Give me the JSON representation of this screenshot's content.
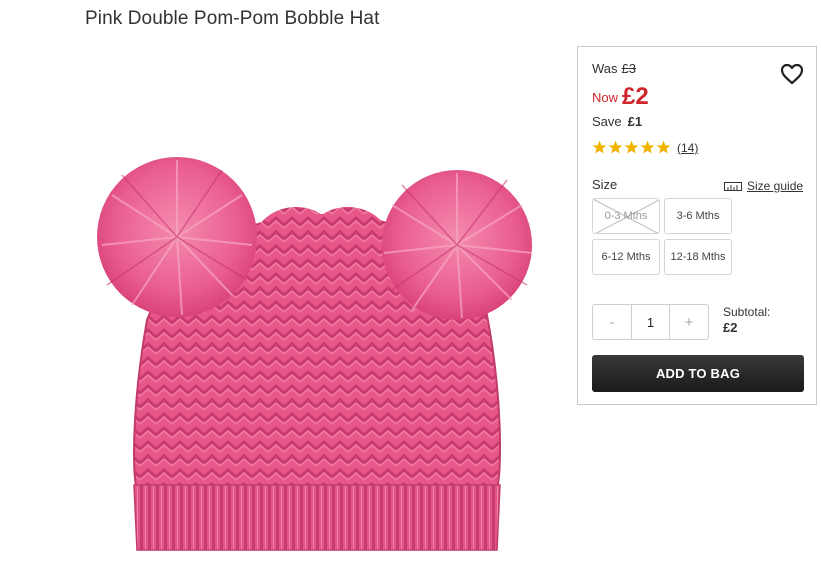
{
  "product": {
    "title": "Pink Double Pom-Pom Bobble Hat"
  },
  "price": {
    "was_label": "Was",
    "was_value": "£3",
    "now_label": "Now",
    "now_value": "£2",
    "save_label": "Save",
    "save_value": "£1",
    "color_now": "#d0252b"
  },
  "rating": {
    "stars": 5,
    "max_stars": 5,
    "review_count": "(14)",
    "star_color": "#f2b400"
  },
  "size": {
    "label": "Size",
    "guide_label": "Size guide",
    "options": [
      {
        "label": "0-3 Mths",
        "available": false
      },
      {
        "label": "3-6 Mths",
        "available": true
      },
      {
        "label": "6-12 Mths",
        "available": true
      },
      {
        "label": "12-18 Mths",
        "available": true
      }
    ]
  },
  "quantity": {
    "minus": "-",
    "value": "1",
    "plus": "+"
  },
  "subtotal": {
    "label": "Subtotal:",
    "value": "£2"
  },
  "actions": {
    "add_to_bag": "ADD TO BAG"
  },
  "icons": {
    "wishlist": "heart-outline-icon",
    "size_guide": "ruler-icon",
    "rating": "star-icon"
  }
}
